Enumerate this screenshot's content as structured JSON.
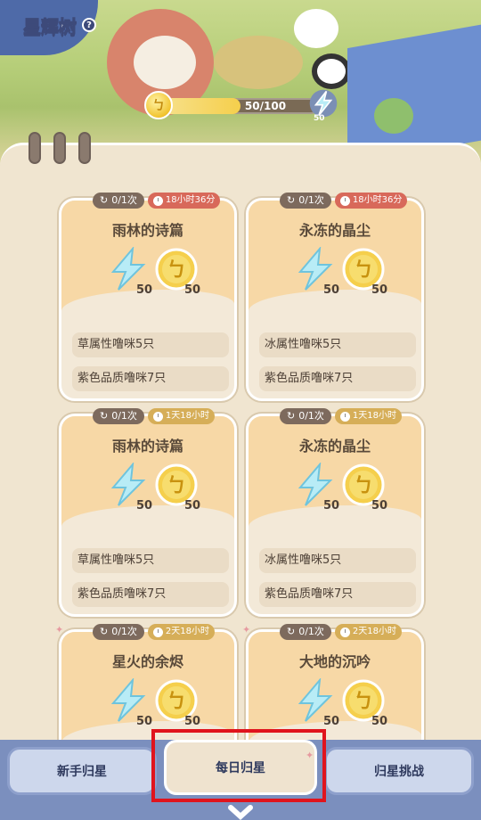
{
  "header": {
    "title": "星辉树",
    "help_glyph": "?"
  },
  "progress": {
    "current": 50,
    "max": 100,
    "text": "50/100",
    "coin_glyph": "ㄅ",
    "energy_bonus": "50"
  },
  "cards": [
    {
      "name": "雨林的诗篇",
      "count": "0/1次",
      "time": "18小时36分",
      "time_style": "red",
      "rewards": {
        "energy": "50",
        "coin": "50"
      },
      "requirements": [
        "草属性噜咪5只",
        "紫色品质噜咪7只"
      ]
    },
    {
      "name": "永冻的晶尘",
      "count": "0/1次",
      "time": "18小时36分",
      "time_style": "red",
      "rewards": {
        "energy": "50",
        "coin": "50"
      },
      "requirements": [
        "冰属性噜咪5只",
        "紫色品质噜咪7只"
      ]
    },
    {
      "name": "雨林的诗篇",
      "count": "0/1次",
      "time": "1天18小时",
      "time_style": "gold",
      "rewards": {
        "energy": "50",
        "coin": "50"
      },
      "requirements": [
        "草属性噜咪5只",
        "紫色品质噜咪7只"
      ]
    },
    {
      "name": "永冻的晶尘",
      "count": "0/1次",
      "time": "1天18小时",
      "time_style": "gold",
      "rewards": {
        "energy": "50",
        "coin": "50"
      },
      "requirements": [
        "冰属性噜咪5只",
        "紫色品质噜咪7只"
      ]
    },
    {
      "name": "星火的余烬",
      "count": "0/1次",
      "time": "2天18小时",
      "time_style": "gold",
      "rewards": {
        "energy": "50",
        "coin": "50"
      },
      "requirements": []
    },
    {
      "name": "大地的沉吟",
      "count": "0/1次",
      "time": "2天18小时",
      "time_style": "gold",
      "rewards": {
        "energy": "50",
        "coin": "50"
      },
      "requirements": []
    }
  ],
  "tabs": {
    "left": "新手归星",
    "center": "每日归星",
    "right": "归星挑战",
    "active": "center"
  },
  "colors": {
    "highlight": "#e0141d",
    "panel": "#f0e5d0",
    "accent": "#f5cf4c",
    "energy": "#9fdcef"
  }
}
